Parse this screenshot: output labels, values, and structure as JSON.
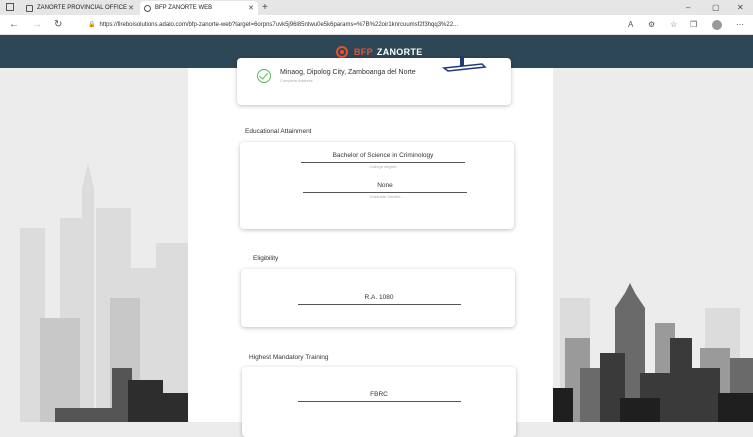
{
  "browser": {
    "tabs": [
      {
        "label": "ZANORTE PROVINCIAL OFFICE",
        "active": false
      },
      {
        "label": "BFP ZANORTE WEB",
        "active": true
      }
    ],
    "new_tab": "+",
    "url": "https://fireboisolutions.adalo.com/bfp-zanorte-web?target=6orpns7uvk5j96l85ntwu0e5k6params=%7B%22oir1knrcuumsf2f3hqq3%22%3A%7B%22id%22%3A10%7D%7D",
    "url_display": "https://fireboisolutions.adalo.com/bfp-zanorte-web?target=6orpns7uvk5j96l85ntwu0e5k6params=%7B%22oir1knrcuumsf2f3hqq3%22...",
    "window_controls": [
      "–",
      "▢",
      "✕"
    ]
  },
  "header": {
    "brand_part1": "BFP",
    "brand_part2": "ZANORTE"
  },
  "address": {
    "value": "Minaog, Dipolog City, Zamboanga del Norte",
    "caption": "Complete Address"
  },
  "education": {
    "title": "Educational Attainment",
    "college_value": "Bachelor of Science in Criminology",
    "college_caption": "College degree",
    "graduate_value": "None",
    "graduate_caption": "Graduate Studies"
  },
  "eligibility": {
    "title": "Eligibility",
    "value": "R.A. 1080"
  },
  "training": {
    "title": "Highest Mandatory Training",
    "value": "FBRC"
  },
  "colors": {
    "header_bg": "#2e4756",
    "brand_accent": "#e8502d",
    "check_green": "#5cb85c"
  }
}
